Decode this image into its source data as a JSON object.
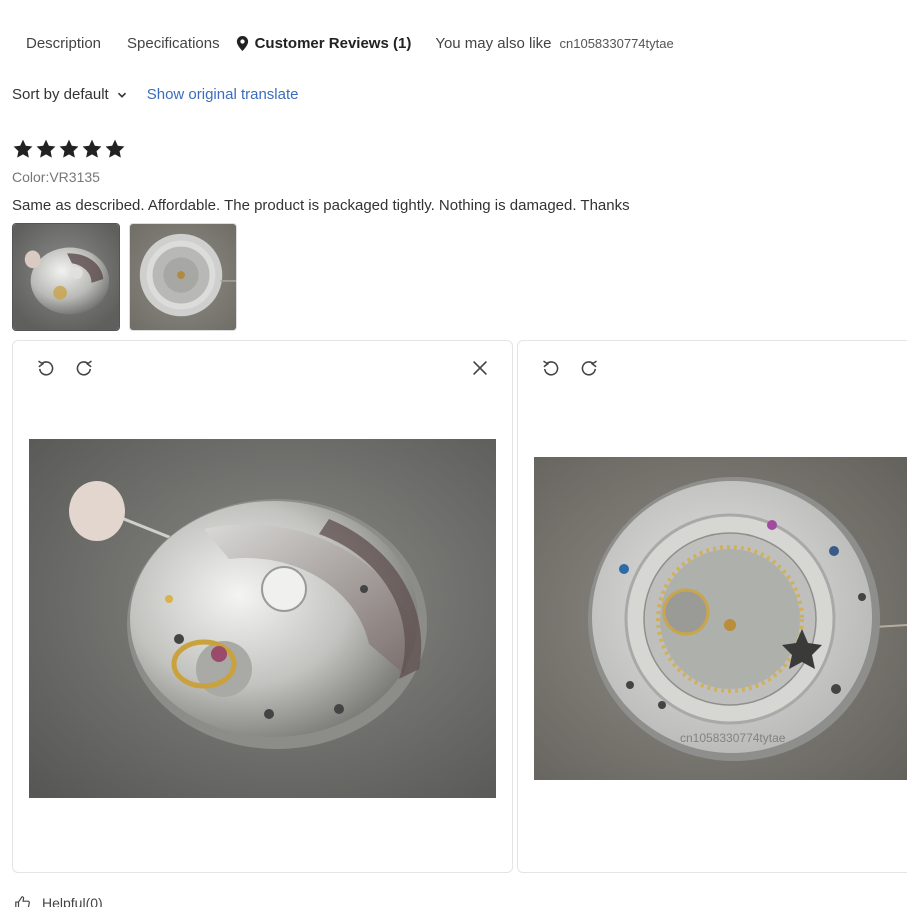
{
  "tabs": {
    "description": "Description",
    "specifications": "Specifications",
    "customer_reviews": "Customer Reviews (1)",
    "also_like": "You may also like",
    "product_code": "cn1058330774tytae"
  },
  "sort": {
    "label": "Sort by default",
    "translate_link": "Show original translate"
  },
  "review": {
    "rating": 5,
    "color": "Color:VR3135",
    "text": "Same as described. Affordable. The product is packaged tightly. Nothing is damaged. Thanks",
    "thumbnails": [
      "watch-movement-rotor-photo",
      "watch-movement-date-wheel-photo"
    ]
  },
  "preview": {
    "watermark": "cn1058330774tytae"
  },
  "helpful": {
    "label": "Helpful(0)"
  },
  "colors": {
    "link": "#3c6dbb",
    "star": "#222222",
    "panel_border": "#e4e4e4"
  }
}
